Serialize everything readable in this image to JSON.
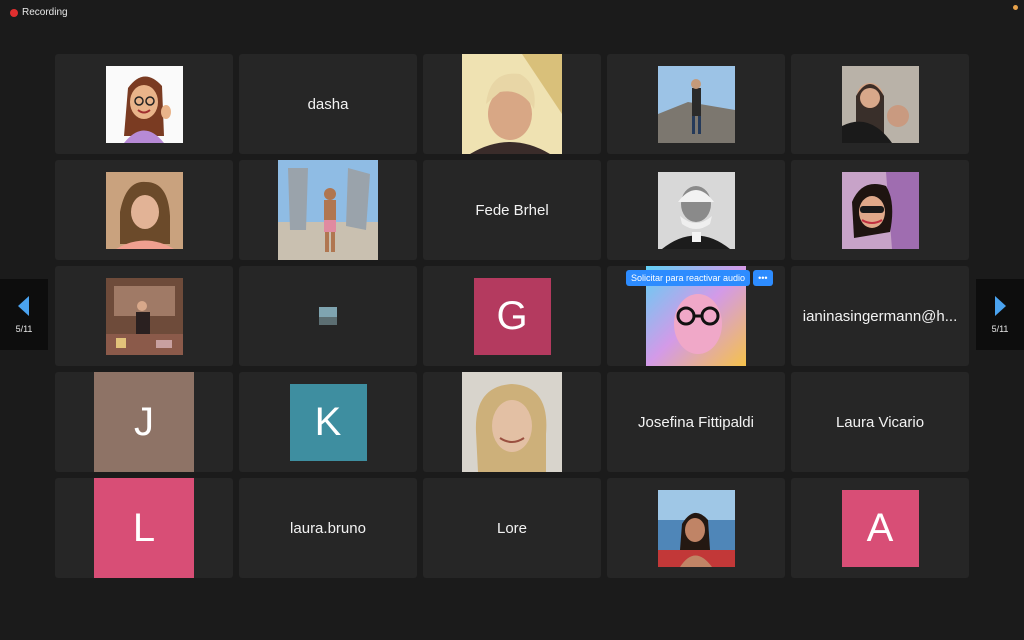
{
  "recording": {
    "label": "Recording"
  },
  "pagination": {
    "left_label": "5/11",
    "right_label": "5/11"
  },
  "audio_request": {
    "label": "Solicitar para reactivar audio",
    "more": "•••"
  },
  "participants": {
    "dasha": "dasha",
    "fede": "Fede Brhel",
    "g_initial": "G",
    "ianina": "ianinasingermann@h...",
    "j_initial": "J",
    "k_initial": "K",
    "josefina": "Josefina Fittipaldi",
    "laura_vicario": "Laura Vicario",
    "l_initial": "L",
    "laura_bruno": "laura.bruno",
    "lore": "Lore",
    "a_initial": "A"
  },
  "colors": {
    "g_tile": "#b43a5f",
    "j_tile": "#8e7366",
    "k_tile": "#3e8ea0",
    "l_tile": "#d84e76",
    "a_tile": "#d84e76",
    "accent": "#2d8cff"
  }
}
